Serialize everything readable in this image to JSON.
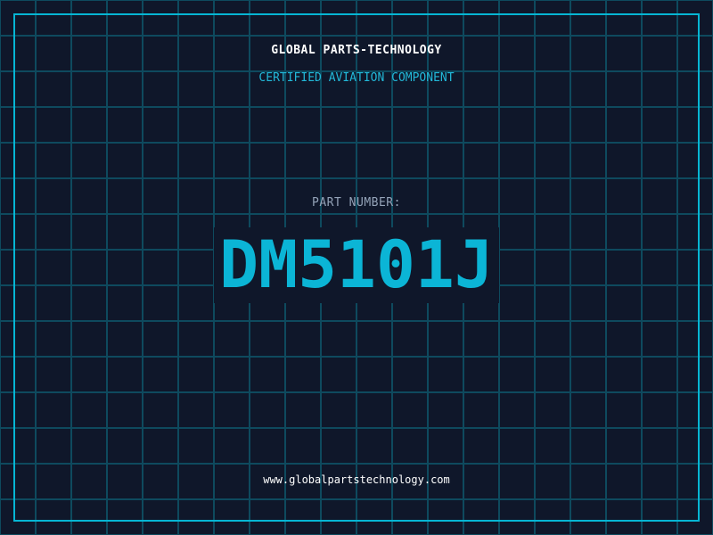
{
  "header": {
    "title": "GLOBAL PARTS-TECHNOLOGY",
    "subtitle": "CERTIFIED AVIATION COMPONENT"
  },
  "part": {
    "label": "PART NUMBER:",
    "number": "DM5101J"
  },
  "footer": {
    "url": "www.globalpartstechnology.com"
  },
  "colors": {
    "background": "#0f172a",
    "accent": "#06b6d4",
    "grid": "#0e4a5e",
    "label": "#94a3b8"
  }
}
